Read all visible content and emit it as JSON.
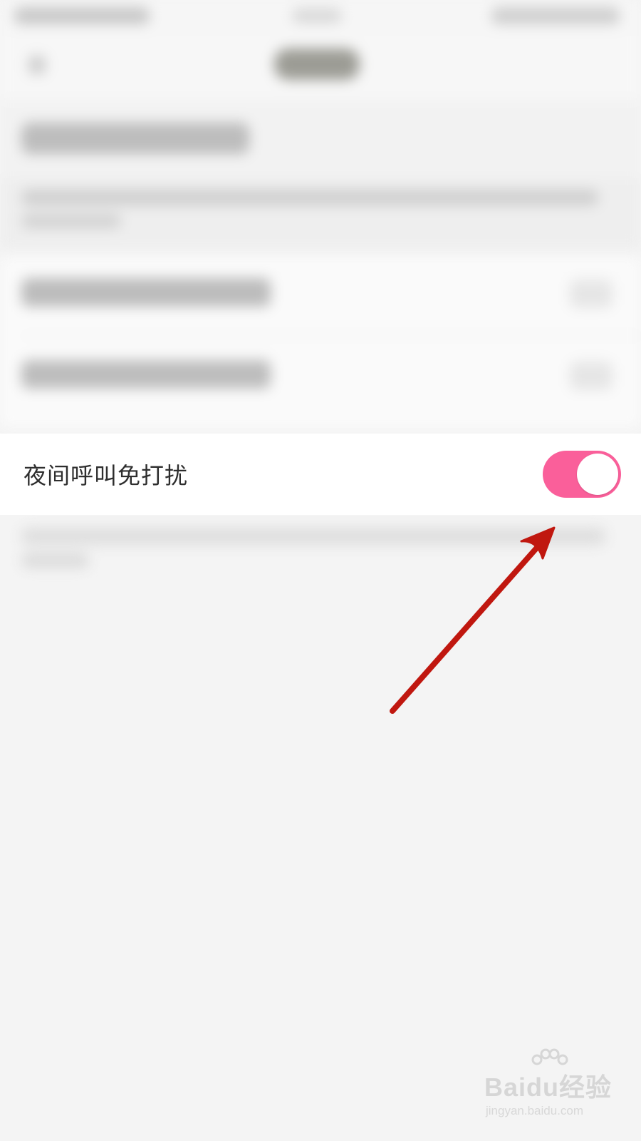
{
  "setting": {
    "label": "夜间呼叫免打扰",
    "enabled": true
  },
  "colors": {
    "toggle_on": "#fa5f9a",
    "arrow": "#c0170f",
    "background": "#f4f4f4"
  },
  "annotation": {
    "type": "arrow",
    "points_to": "toggle-switch"
  },
  "watermark": {
    "logo": "Baidu经验",
    "url": "jingyan.baidu.com"
  }
}
